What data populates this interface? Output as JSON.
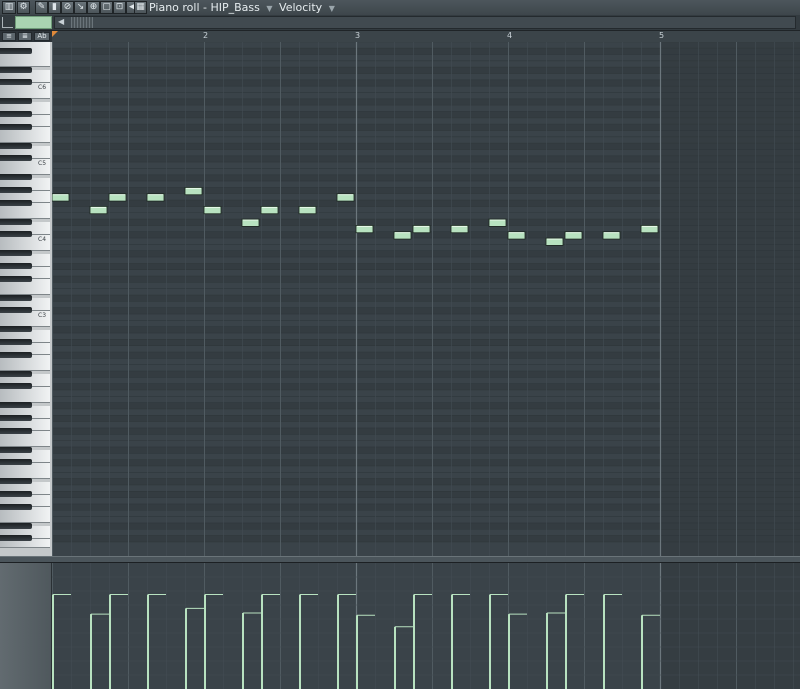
{
  "window": {
    "title": "Piano roll - HIP_Bass",
    "target_label": "Velocity"
  },
  "toolbar": {
    "icons": [
      "piano-icon",
      "wrench-icon",
      "pencil-icon",
      "paint-icon",
      "delete-icon",
      "mute-icon",
      "slice-icon",
      "select-icon",
      "zoom-icon",
      "speaker-icon",
      "snap-icon"
    ]
  },
  "ruler": {
    "bars": [
      "2",
      "3",
      "4",
      "5"
    ]
  },
  "keyboard": {
    "octave_labels": [
      "C6",
      "C5",
      "C4",
      "C3"
    ]
  },
  "notes": [
    {
      "step": 0,
      "pitch": 55
    },
    {
      "step": 2,
      "pitch": 53
    },
    {
      "step": 3,
      "pitch": 55
    },
    {
      "step": 5,
      "pitch": 55
    },
    {
      "step": 7,
      "pitch": 56
    },
    {
      "step": 8,
      "pitch": 53
    },
    {
      "step": 10,
      "pitch": 51
    },
    {
      "step": 11,
      "pitch": 53
    },
    {
      "step": 13,
      "pitch": 53
    },
    {
      "step": 15,
      "pitch": 55
    },
    {
      "step": 16,
      "pitch": 50
    },
    {
      "step": 18,
      "pitch": 49
    },
    {
      "step": 19,
      "pitch": 50
    },
    {
      "step": 21,
      "pitch": 50
    },
    {
      "step": 23,
      "pitch": 51
    },
    {
      "step": 24,
      "pitch": 49
    },
    {
      "step": 26,
      "pitch": 48
    },
    {
      "step": 27,
      "pitch": 49
    },
    {
      "step": 29,
      "pitch": 49
    },
    {
      "step": 31,
      "pitch": 50
    }
  ],
  "velocities": [
    0.82,
    0.65,
    0.82,
    0.82,
    0.7,
    0.82,
    0.66,
    0.82,
    0.82,
    0.82,
    0.64,
    0.54,
    0.82,
    0.82,
    0.82,
    0.65,
    0.66,
    0.82,
    0.82,
    0.64
  ],
  "colors": {
    "note": "#b8e2c0",
    "velocity": "#b8e2c0",
    "grid_bg": "#3a4349"
  }
}
